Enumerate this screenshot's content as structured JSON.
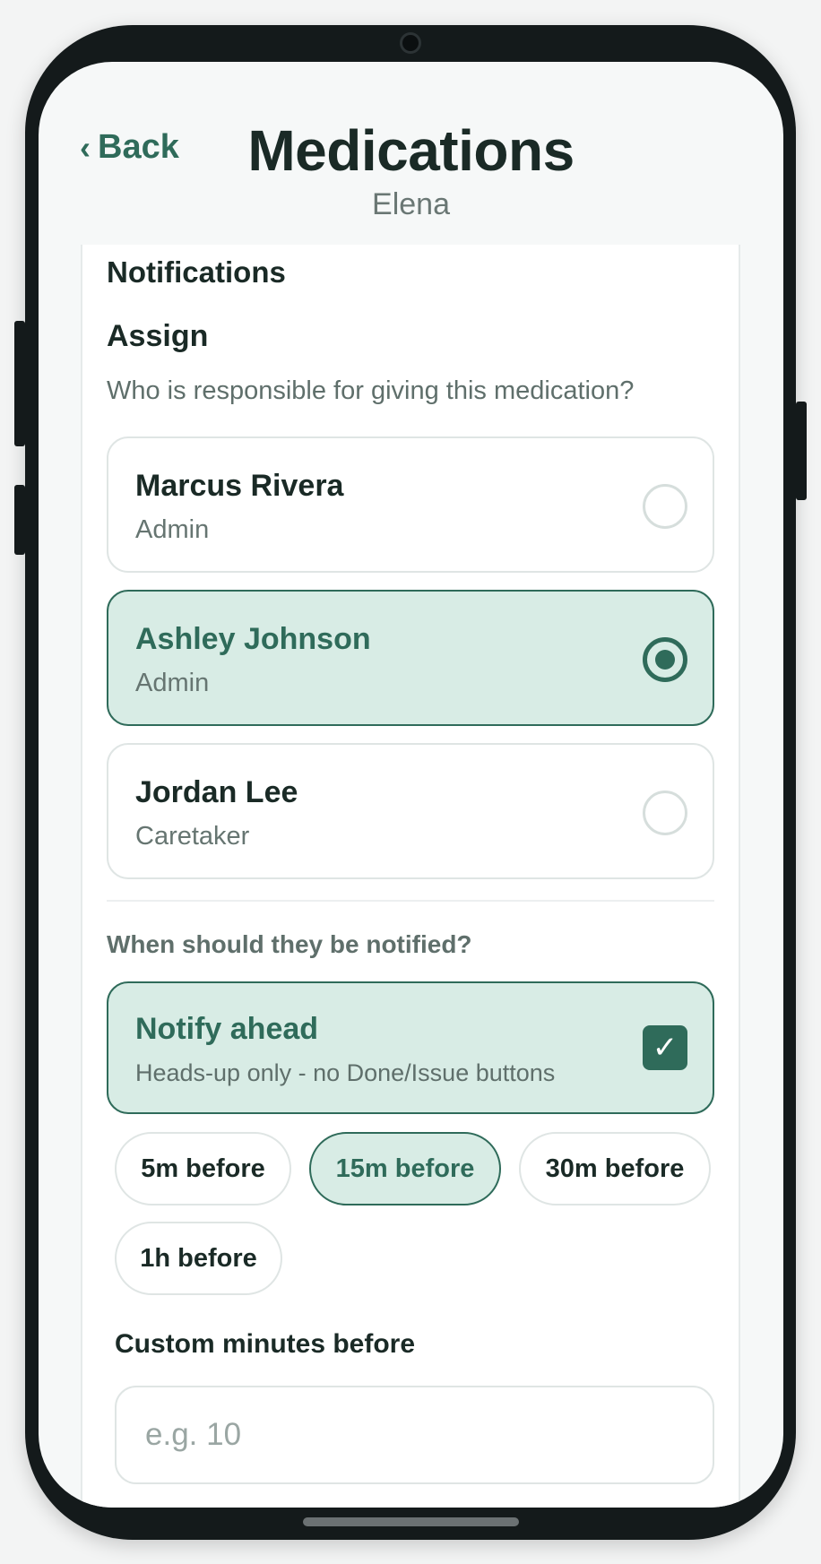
{
  "header": {
    "back_label": "Back",
    "back_chevron": "‹",
    "title": "Medications",
    "subtitle": "Elena"
  },
  "card": {
    "section_title": "Notifications",
    "assign": {
      "title": "Assign",
      "question": "Who is responsible for giving this medication?",
      "people": [
        {
          "name": "Marcus Rivera",
          "role": "Admin",
          "selected": false
        },
        {
          "name": "Ashley Johnson",
          "role": "Admin",
          "selected": true
        },
        {
          "name": "Jordan Lee",
          "role": "Caretaker",
          "selected": false
        }
      ]
    },
    "notify": {
      "question": "When should they be notified?",
      "option_title": "Notify ahead",
      "option_subtitle": "Heads-up only - no Done/Issue buttons",
      "checked": true,
      "check_glyph": "✓",
      "chips": [
        {
          "label": "5m before",
          "active": false
        },
        {
          "label": "15m before",
          "active": true
        },
        {
          "label": "30m before",
          "active": false
        },
        {
          "label": "1h before",
          "active": false
        }
      ],
      "custom_label": "Custom minutes before",
      "custom_placeholder": "e.g. 10",
      "custom_value": ""
    }
  },
  "colors": {
    "accent": "#2f6b5a",
    "accent_bg": "#d8ece5",
    "text": "#1a2a26",
    "muted": "#5f6f6b"
  }
}
